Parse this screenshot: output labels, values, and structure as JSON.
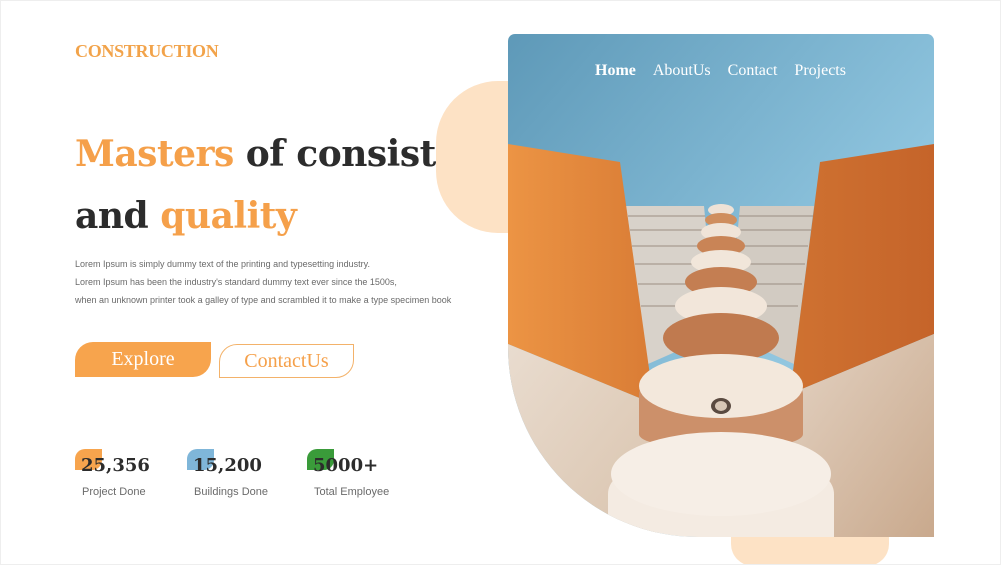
{
  "brand": "CONSTRUCTION",
  "nav": {
    "items": [
      "Home",
      "AboutUs",
      "Contact",
      "Projects"
    ],
    "active": "Home"
  },
  "hero": {
    "headline_word1": "Masters",
    "headline_rest1": " of consistency",
    "headline_word2": "and ",
    "headline_word3": "quality",
    "description": [
      "Lorem Ipsum is simply dummy text of the printing and typesetting industry.",
      "Lorem Ipsum has been the industry's standard dummy text ever since the 1500s,",
      "when an unknown printer took a galley of type and scrambled it to make a type specimen book"
    ]
  },
  "buttons": {
    "explore": "Explore",
    "contact": "ContactUs"
  },
  "stats": [
    {
      "value": "25,356",
      "label": "Project Done",
      "color": "#f7a44d"
    },
    {
      "value": "15,200",
      "label": "Buildings Done",
      "color": "#7fb6d9"
    },
    {
      "value": "5000+",
      "label": "Total Employee",
      "color": "#3a9b3a"
    }
  ],
  "colors": {
    "accent": "#f5a04a",
    "blob": "#fde2c5",
    "text": "#2c2c2c"
  },
  "image": {
    "subject": "building-photo"
  }
}
